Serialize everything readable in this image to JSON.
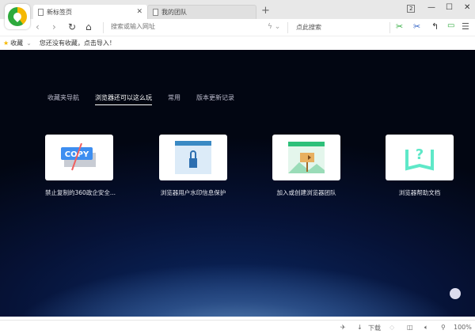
{
  "tabs": [
    {
      "label": "新标签页",
      "active": true
    },
    {
      "label": "我的团队",
      "active": false
    }
  ],
  "window": {
    "tab_count": "2"
  },
  "address": {
    "placeholder": "搜索或输入网址",
    "search_label": "点此搜索"
  },
  "bookmarks": {
    "label": "收藏",
    "empty_text": "您还没有收藏，点击导入！"
  },
  "newtab": {
    "nav": [
      {
        "label": "收藏夹导航"
      },
      {
        "label": "浏览器还可以这么玩",
        "active": true
      },
      {
        "label": "常用"
      },
      {
        "label": "版本更新记录"
      }
    ],
    "cards": [
      {
        "label": "禁止复制的360政企安全...",
        "icon": "copy-forbidden-icon",
        "copy_text": "COPY"
      },
      {
        "label": "浏览器用户水印信息保护",
        "icon": "watermark-lock-icon"
      },
      {
        "label": "加入或创建浏览器团队",
        "icon": "team-signpost-icon"
      },
      {
        "label": "浏览器帮助文档",
        "icon": "help-book-icon"
      }
    ]
  },
  "status": {
    "download": "下载",
    "zoom": "100%"
  },
  "colors": {
    "accent_green": "#2eaa3c",
    "copy_blue": "#3d8ef0",
    "help_teal": "#5ee8c8"
  }
}
